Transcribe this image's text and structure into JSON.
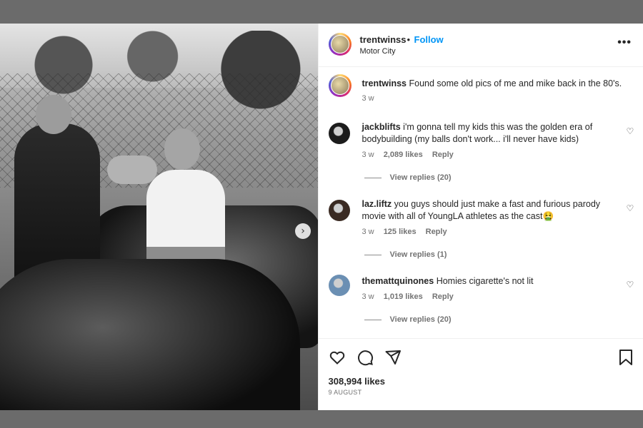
{
  "post": {
    "username": "trentwinss",
    "separator": "•",
    "follow_label": "Follow",
    "location": "Motor City",
    "more_icon": "more-options-icon",
    "more_glyph": "•••",
    "next_glyph": "›"
  },
  "caption": {
    "username": "trentwinss",
    "text": "Found some old pics of me and mike back in the 80's.",
    "time": "3 w"
  },
  "comments": [
    {
      "username": "jackblifts",
      "text": "i'm gonna tell my kids this was the golden era of bodybuilding (my balls don't work... i'll never have kids)",
      "time": "3 w",
      "likes": "2,089 likes",
      "reply": "Reply",
      "view_replies": "View replies (20)",
      "avatar_color": "#1c1c1c"
    },
    {
      "username": "laz.liftz",
      "text": "you guys should just make a fast and furious parody movie with all of YoungLA athletes as the cast🤮",
      "time": "3 w",
      "likes": "125 likes",
      "reply": "Reply",
      "view_replies": "View replies (1)",
      "avatar_color": "#3a2a22"
    },
    {
      "username": "themattquinones",
      "text": "Homies cigarette's not lit",
      "time": "3 w",
      "likes": "1,019 likes",
      "reply": "Reply",
      "view_replies": "View replies (20)",
      "avatar_color": "#6b8fb3"
    }
  ],
  "heart_glyph": "♡",
  "footer": {
    "likes": "308,994 likes",
    "date": "9 AUGUST"
  }
}
